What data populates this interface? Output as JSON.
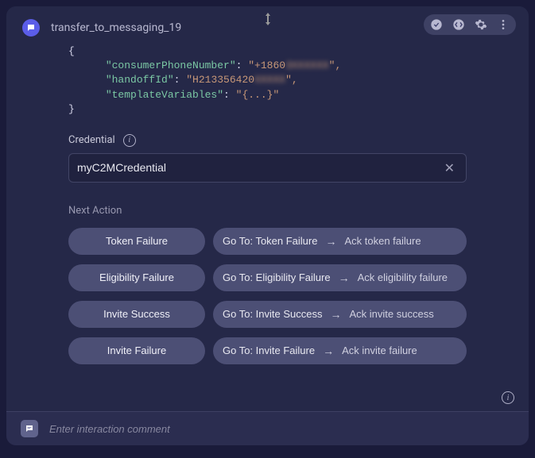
{
  "header": {
    "title": "transfer_to_messaging_19"
  },
  "code": {
    "open": "{",
    "line1_key": "\"consumerPhoneNumber\"",
    "line1_val_visible": "\"+1860",
    "line1_val_blur": "3XXXXXX",
    "line1_val_end": "\",",
    "line2_key": "\"handoffId\"",
    "line2_val_visible": "\"H213356420",
    "line2_val_blur": "XXXXX",
    "line2_val_end": "\",",
    "line3_key": "\"templateVariables\"",
    "line3_val": "\"{...}\"",
    "close": "}"
  },
  "credential": {
    "label": "Credential",
    "value": "myC2MCredential"
  },
  "nextAction": {
    "label": "Next Action",
    "rows": [
      {
        "name": "Token Failure",
        "goto": "Go To: Token Failure",
        "ack": "Ack token failure"
      },
      {
        "name": "Eligibility Failure",
        "goto": "Go To: Eligibility Failure",
        "ack": "Ack eligibility failure"
      },
      {
        "name": "Invite Success",
        "goto": "Go To: Invite Success",
        "ack": "Ack invite success"
      },
      {
        "name": "Invite Failure",
        "goto": "Go To: Invite Failure",
        "ack": "Ack invite failure"
      }
    ]
  },
  "footer": {
    "placeholder": "Enter interaction comment"
  }
}
